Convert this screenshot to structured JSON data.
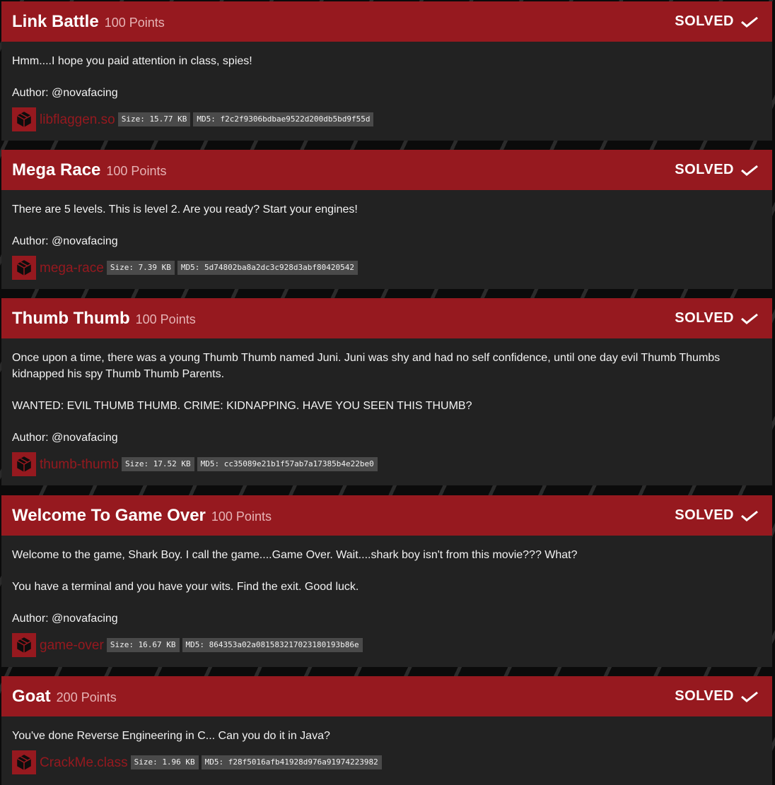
{
  "challenges": [
    {
      "title": "Link Battle",
      "points": "100 Points",
      "status": "SOLVED",
      "description": [
        "Hmm....I hope you paid attention in class, spies!"
      ],
      "author": "Author: @novafacing",
      "file": {
        "name": "libflaggen.so",
        "size": "Size: 15.77 KB",
        "md5": "MD5: f2c2f9306bdbae9522d200db5bd9f55d"
      }
    },
    {
      "title": "Mega Race",
      "points": "100 Points",
      "status": "SOLVED",
      "description": [
        "There are 5 levels. This is level 2. Are you ready? Start your engines!"
      ],
      "author": "Author: @novafacing",
      "file": {
        "name": "mega-race",
        "size": "Size: 7.39 KB",
        "md5": "MD5: 5d74802ba8a2dc3c928d3abf80420542"
      }
    },
    {
      "title": "Thumb Thumb",
      "points": "100 Points",
      "status": "SOLVED",
      "description": [
        "Once upon a time, there was a young Thumb Thumb named Juni. Juni was shy and had no self confidence, until one day evil Thumb Thumbs kidnapped his spy Thumb Thumb Parents.",
        "WANTED: EVIL THUMB THUMB. CRIME: KIDNAPPING. HAVE YOU SEEN THIS THUMB?"
      ],
      "author": "Author: @novafacing",
      "file": {
        "name": "thumb-thumb",
        "size": "Size: 17.52 KB",
        "md5": "MD5: cc35089e21b1f57ab7a17385b4e22be0"
      }
    },
    {
      "title": "Welcome To Game Over",
      "points": "100 Points",
      "status": "SOLVED",
      "description": [
        "Welcome to the game, Shark Boy. I call the game....Game Over. Wait....shark boy isn't from this movie??? What?",
        "You have a terminal and you have your wits. Find the exit. Good luck."
      ],
      "author": "Author: @novafacing",
      "file": {
        "name": "game-over",
        "size": "Size: 16.67 KB",
        "md5": "MD5: 864353a02a081583217023180193b86e"
      }
    },
    {
      "title": "Goat",
      "points": "200 Points",
      "status": "SOLVED",
      "description": [
        "You've done Reverse Engineering in C... Can you do it in Java?"
      ],
      "author": "",
      "file": {
        "name": "CrackMe.class",
        "size": "Size: 1.96 KB",
        "md5": "MD5: f28f5016afb41928d976a91974223982"
      }
    }
  ],
  "icons": {
    "solved": "checkmark-icon",
    "file": "package-box-icon"
  },
  "colors": {
    "accent": "#96191f",
    "card_background": "#222222",
    "tag_background": "#4a4a4a"
  }
}
